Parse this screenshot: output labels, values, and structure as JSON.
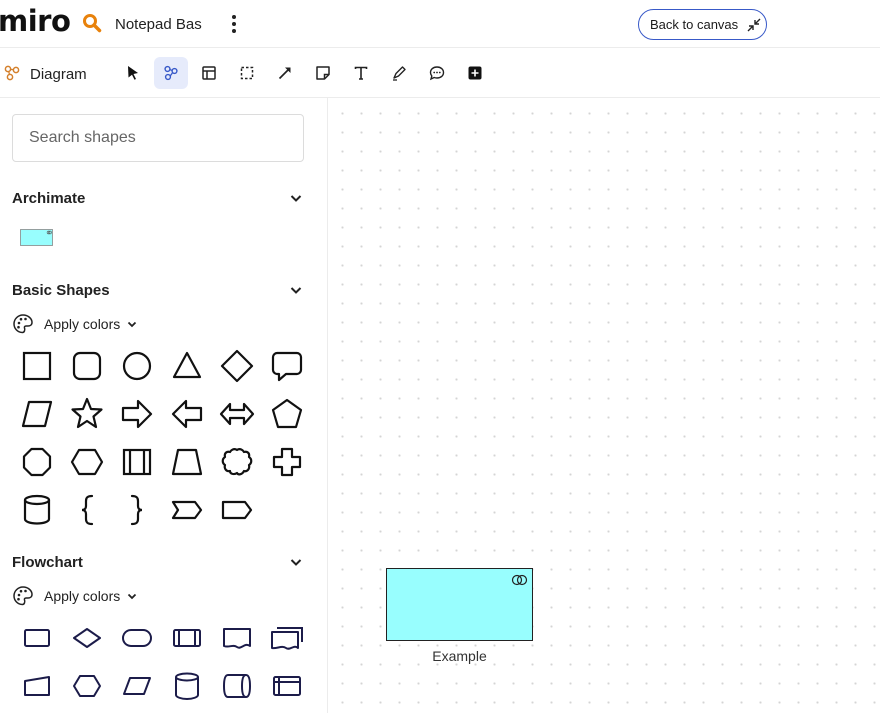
{
  "header": {
    "logo": "miro",
    "board_name": "Notepad Bas",
    "back_button": "Back to canvas"
  },
  "toolbar": {
    "mode_label": "Diagram",
    "tools": [
      "select-icon",
      "diagram-icon",
      "frame-icon",
      "marquee-icon",
      "connector-icon",
      "sticky-note-icon",
      "text-icon",
      "pen-icon",
      "comment-icon",
      "add-icon"
    ]
  },
  "sidebar": {
    "search_placeholder": "Search shapes",
    "sections": [
      {
        "title": "Archimate"
      },
      {
        "title": "Basic Shapes",
        "apply_label": "Apply colors"
      },
      {
        "title": "Flowchart",
        "apply_label": "Apply colors"
      }
    ]
  },
  "canvas": {
    "example_label": "Example",
    "example_fill": "#98fefe"
  },
  "colors": {
    "accent": "#3859c8",
    "tool_active_bg": "#e6ebfb",
    "search_icon": "#e8820c",
    "flowchart_stroke": "#1c1c4a"
  }
}
